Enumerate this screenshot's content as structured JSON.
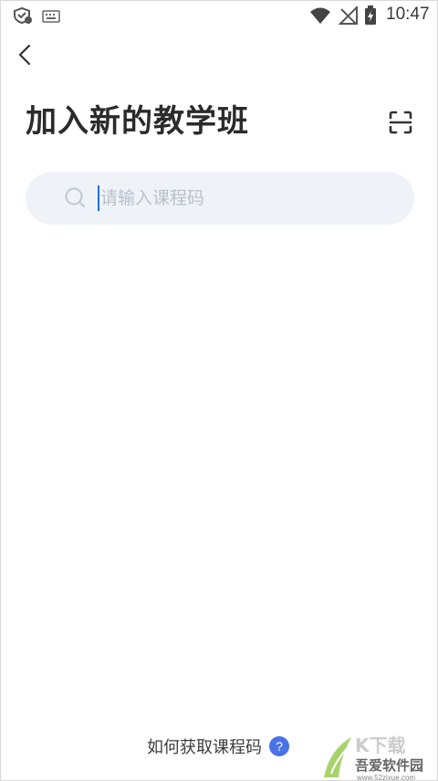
{
  "status_bar": {
    "time": "10:47"
  },
  "header": {
    "title": "加入新的教学班"
  },
  "search": {
    "placeholder": "请输入课程码",
    "value": ""
  },
  "help": {
    "label": "如何获取课程码",
    "icon_glyph": "?"
  },
  "watermark": {
    "text": "吾爱软件园",
    "url_text": "www.52zixue.com"
  },
  "colors": {
    "accent": "#4a72e8",
    "search_bg": "#eff3f8",
    "caret": "#1f6fe0"
  }
}
